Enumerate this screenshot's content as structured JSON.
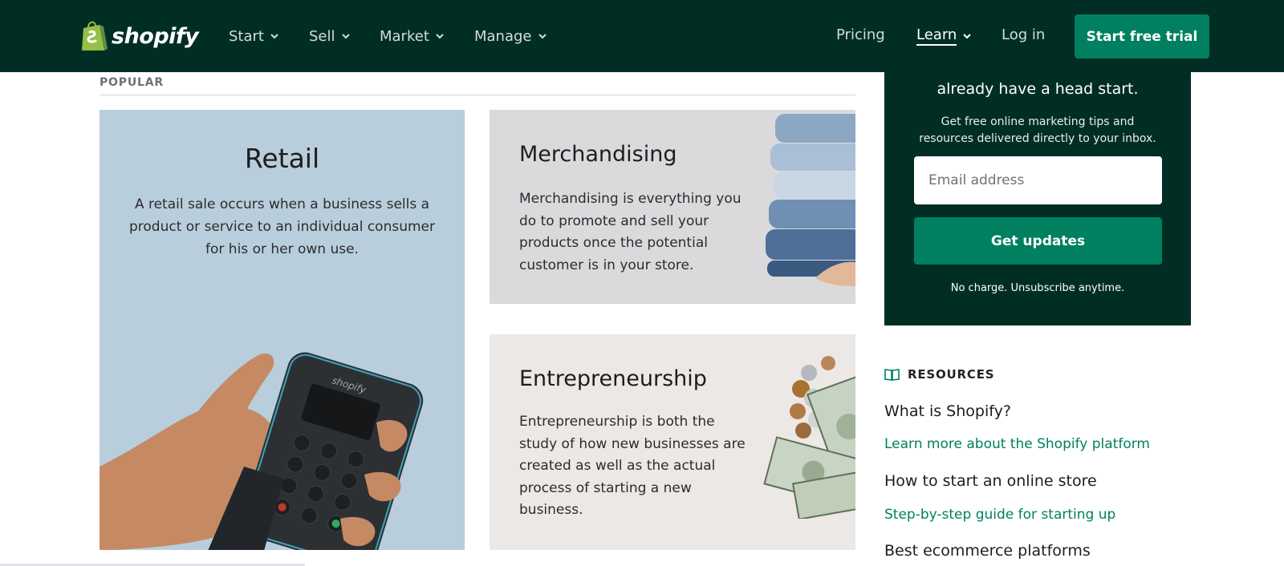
{
  "header": {
    "brand": "shopify",
    "nav": [
      {
        "label": "Start"
      },
      {
        "label": "Sell"
      },
      {
        "label": "Market"
      },
      {
        "label": "Manage"
      }
    ],
    "pricing": "Pricing",
    "learn": "Learn",
    "login": "Log in",
    "cta": "Start free trial"
  },
  "popular": {
    "label": "POPULAR",
    "cards": [
      {
        "title": "Retail",
        "description": "A retail sale occurs when a business sells a product or service to an individual consumer for his or her own use."
      },
      {
        "title": "Merchandising",
        "description": "Merchandising is everything you do to promote and sell your products once the potential customer is in your store."
      },
      {
        "title": "Entrepreneurship",
        "description": "Entrepreneurship is both the study of how new businesses are created as well as the actual process of starting a new business."
      }
    ]
  },
  "newsletter": {
    "heading": "already have a head start.",
    "subtext": "Get free online marketing tips and resources delivered directly to your inbox.",
    "email_placeholder": "Email address",
    "button": "Get updates",
    "footnote": "No charge. Unsubscribe anytime."
  },
  "resources": {
    "label": "RESOURCES",
    "items": [
      {
        "title": "What is Shopify?",
        "link": "Learn more about the Shopify platform"
      },
      {
        "title": "How to start an online store",
        "link": "Step-by-step guide for starting up"
      },
      {
        "title": "Best ecommerce platforms"
      }
    ]
  },
  "colors": {
    "header_bg": "#002e25",
    "accent_green": "#008060",
    "retail_card": "#b9cedc",
    "merch_card": "#dadadd",
    "entre_card": "#ece8e6"
  },
  "icons": {
    "logo": "shopify-bag-icon",
    "nav_chevron": "chevron-down-icon",
    "resources": "book-icon"
  }
}
